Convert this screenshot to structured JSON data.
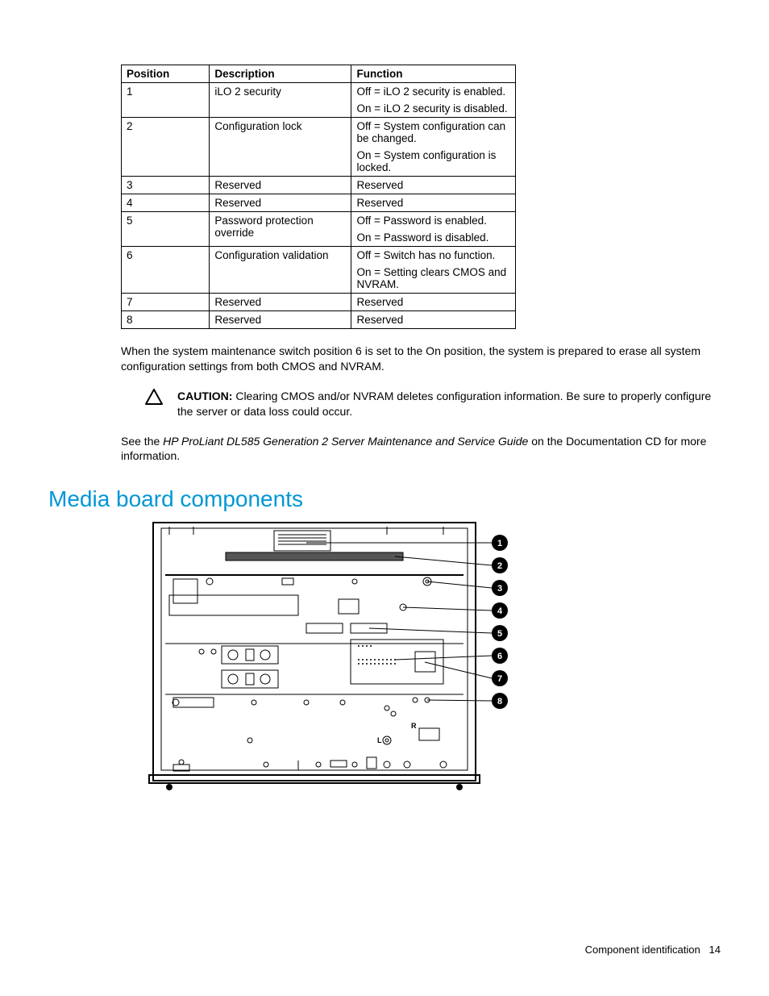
{
  "table": {
    "headers": {
      "position": "Position",
      "description": "Description",
      "function": "Function"
    },
    "rows": [
      {
        "position": "1",
        "description": "iLO 2 security",
        "function": [
          "Off = iLO 2 security is enabled.",
          "On = iLO 2 security is disabled."
        ]
      },
      {
        "position": "2",
        "description": "Configuration lock",
        "function": [
          "Off = System configuration can be changed.",
          "On = System configuration is locked."
        ]
      },
      {
        "position": "3",
        "description": "Reserved",
        "function": [
          "Reserved"
        ]
      },
      {
        "position": "4",
        "description": "Reserved",
        "function": [
          "Reserved"
        ]
      },
      {
        "position": "5",
        "description": "Password protection override",
        "function": [
          "Off = Password is enabled.",
          "On = Password is disabled."
        ]
      },
      {
        "position": "6",
        "description": "Configuration validation",
        "function": [
          "Off = Switch has no function.",
          "On = Setting clears CMOS and NVRAM."
        ]
      },
      {
        "position": "7",
        "description": "Reserved",
        "function": [
          "Reserved"
        ]
      },
      {
        "position": "8",
        "description": "Reserved",
        "function": [
          "Reserved"
        ]
      }
    ]
  },
  "para_switch6": "When the system maintenance switch position 6 is set to the On position, the system is prepared to erase all system configuration settings from both CMOS and NVRAM.",
  "caution": {
    "label": "CAUTION:",
    "text": "Clearing CMOS and/or NVRAM deletes configuration information. Be sure to properly configure the server or data loss could occur."
  },
  "para_see": {
    "prefix": "See the ",
    "italic": "HP ProLiant DL585 Generation 2 Server Maintenance and Service Guide",
    "suffix": " on the Documentation CD for more information."
  },
  "heading": "Media board components",
  "callouts": [
    "1",
    "2",
    "3",
    "4",
    "5",
    "6",
    "7",
    "8"
  ],
  "footer": {
    "section": "Component identification",
    "page": "14"
  }
}
